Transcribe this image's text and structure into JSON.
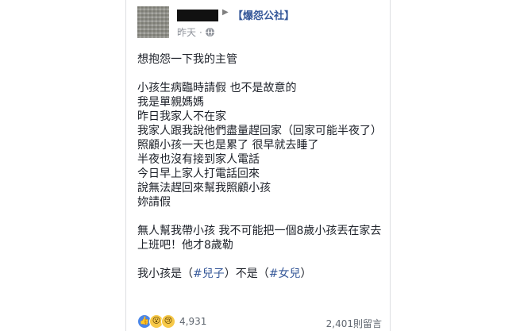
{
  "post": {
    "author": {
      "group": "【爆怨公社】"
    },
    "time": "昨天",
    "audience_icon": "globe-icon",
    "lines": [
      {
        "text": "想抱怨一下我的主管"
      },
      {
        "text": ""
      },
      {
        "text": "小孩生病臨時請假 也不是故意的"
      },
      {
        "text": "我是單親媽媽"
      },
      {
        "text": "昨日我家人不在家"
      },
      {
        "text": "我家人跟我說他們盡量趕回家（回家可能半夜了）"
      },
      {
        "text": "照顧小孩一天也是累了 很早就去睡了"
      },
      {
        "text": "半夜也沒有接到家人電話"
      },
      {
        "text": "今日早上家人打電話回來"
      },
      {
        "text": "說無法趕回來幫我照顧小孩"
      },
      {
        "text": "妳請假"
      },
      {
        "text": ""
      },
      {
        "text": "無人幫我帶小孩 我不可能把一個8歲小孩丟在家去上班吧！他才8歲勒"
      },
      {
        "text": ""
      }
    ],
    "last_line": {
      "prefix": "我小孩是（",
      "tag1": "#兒子",
      "middle": "）不是（",
      "tag2": "#女兒",
      "suffix": "）"
    },
    "reactions": {
      "icons": [
        "like-icon",
        "wow-icon",
        "sad-icon"
      ],
      "count": "4,931"
    },
    "comments": "2,401則留言"
  }
}
